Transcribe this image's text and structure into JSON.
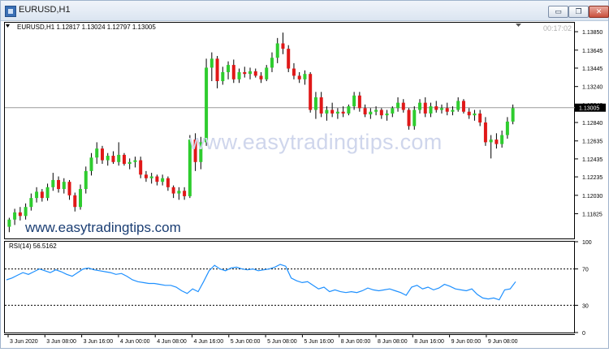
{
  "window": {
    "title": "EURUSD,H1",
    "controls": {
      "minimize": "▭",
      "restore": "❐",
      "close": "✕"
    }
  },
  "chart_info": {
    "symbol_line": "EURUSD,H1  1.12817 1.13024 1.12797 1.13005",
    "countdown": "00:17:02",
    "current_price": "1.13005"
  },
  "watermarks": {
    "center": "www.easytradingtips.com",
    "bottom_left": "www.easytradingtips.com"
  },
  "indicator": {
    "label": "RSI(14) 56.5162"
  },
  "colors": {
    "bull": "#2ecc2e",
    "bear": "#e01818",
    "rsi_line": "#1e90ff",
    "price_line": "#9a9a9a"
  },
  "chart_data": [
    {
      "type": "candlestick",
      "title": "EURUSD,H1",
      "ylim": [
        1.1155,
        1.1395
      ],
      "y_ticks": [
        "1.13850",
        "1.13645",
        "1.13445",
        "1.13240",
        "1.13040",
        "1.12840",
        "1.12635",
        "1.12435",
        "1.12235",
        "1.12030",
        "1.11825"
      ],
      "x_ticks": [
        "3 Jun 2020",
        "3 Jun 08:00",
        "3 Jun 16:00",
        "4 Jun 00:00",
        "4 Jun 08:00",
        "4 Jun 16:00",
        "5 Jun 00:00",
        "5 Jun 08:00",
        "5 Jun 16:00",
        "8 Jun 00:00",
        "8 Jun 08:00",
        "8 Jun 16:00",
        "9 Jun 00:00",
        "9 Jun 08:00"
      ],
      "current_price": 1.13005,
      "candles": [
        [
          1.1168,
          1.1178,
          1.1162,
          1.1176
        ],
        [
          1.1176,
          1.1188,
          1.117,
          1.1184
        ],
        [
          1.1184,
          1.119,
          1.1175,
          1.118
        ],
        [
          1.118,
          1.1194,
          1.1176,
          1.119
        ],
        [
          1.119,
          1.1205,
          1.1186,
          1.12
        ],
        [
          1.12,
          1.1212,
          1.1195,
          1.1207
        ],
        [
          1.1207,
          1.121,
          1.1196,
          1.12
        ],
        [
          1.12,
          1.1216,
          1.1197,
          1.1212
        ],
        [
          1.1212,
          1.1228,
          1.1208,
          1.122
        ],
        [
          1.122,
          1.1224,
          1.1206,
          1.121
        ],
        [
          1.121,
          1.1222,
          1.1205,
          1.1218
        ],
        [
          1.1218,
          1.122,
          1.1198,
          1.1203
        ],
        [
          1.1203,
          1.1206,
          1.1185,
          1.119
        ],
        [
          1.119,
          1.1215,
          1.1187,
          1.121
        ],
        [
          1.121,
          1.1235,
          1.1205,
          1.123
        ],
        [
          1.123,
          1.125,
          1.1225,
          1.1245
        ],
        [
          1.1245,
          1.1262,
          1.1238,
          1.1255
        ],
        [
          1.1255,
          1.1258,
          1.1238,
          1.1242
        ],
        [
          1.1242,
          1.125,
          1.1236,
          1.1247
        ],
        [
          1.1247,
          1.1252,
          1.1238,
          1.124
        ],
        [
          1.124,
          1.1262,
          1.1236,
          1.1248
        ],
        [
          1.1248,
          1.125,
          1.1236,
          1.1238
        ],
        [
          1.1238,
          1.1244,
          1.1232,
          1.124
        ],
        [
          1.124,
          1.1246,
          1.1234,
          1.1242
        ],
        [
          1.1242,
          1.1246,
          1.1222,
          1.1226
        ],
        [
          1.1226,
          1.123,
          1.1218,
          1.1222
        ],
        [
          1.1222,
          1.1228,
          1.1216,
          1.1224
        ],
        [
          1.1224,
          1.1226,
          1.1214,
          1.1218
        ],
        [
          1.1218,
          1.1226,
          1.1214,
          1.1222
        ],
        [
          1.1222,
          1.1224,
          1.1208,
          1.1212
        ],
        [
          1.1212,
          1.1214,
          1.12,
          1.1205
        ],
        [
          1.1205,
          1.1212,
          1.1198,
          1.1208
        ],
        [
          1.1208,
          1.1212,
          1.1198,
          1.1202
        ],
        [
          1.1202,
          1.127,
          1.12,
          1.1265
        ],
        [
          1.1265,
          1.1272,
          1.123,
          1.124
        ],
        [
          1.124,
          1.1268,
          1.1232,
          1.1262
        ],
        [
          1.1262,
          1.1355,
          1.1258,
          1.1345
        ],
        [
          1.1345,
          1.1362,
          1.133,
          1.1355
        ],
        [
          1.1355,
          1.1358,
          1.1322,
          1.133
        ],
        [
          1.133,
          1.1346,
          1.1326,
          1.134
        ],
        [
          1.134,
          1.1352,
          1.1332,
          1.1348
        ],
        [
          1.1348,
          1.1354,
          1.1328,
          1.1332
        ],
        [
          1.1332,
          1.1344,
          1.1328,
          1.134
        ],
        [
          1.134,
          1.1346,
          1.1334,
          1.1338
        ],
        [
          1.1338,
          1.1345,
          1.1332,
          1.1341
        ],
        [
          1.1341,
          1.1344,
          1.1334,
          1.1336
        ],
        [
          1.1336,
          1.134,
          1.1328,
          1.1332
        ],
        [
          1.1332,
          1.1348,
          1.133,
          1.1345
        ],
        [
          1.1345,
          1.1362,
          1.134,
          1.1356
        ],
        [
          1.1356,
          1.1378,
          1.135,
          1.1372
        ],
        [
          1.1372,
          1.1384,
          1.136,
          1.1366
        ],
        [
          1.1366,
          1.137,
          1.134,
          1.1344
        ],
        [
          1.1344,
          1.135,
          1.1332,
          1.1336
        ],
        [
          1.1336,
          1.134,
          1.1328,
          1.1332
        ],
        [
          1.1332,
          1.1342,
          1.1326,
          1.1338
        ],
        [
          1.1338,
          1.134,
          1.1295,
          1.1298
        ],
        [
          1.1298,
          1.1318,
          1.1288,
          1.1312
        ],
        [
          1.1312,
          1.1318,
          1.129,
          1.1294
        ],
        [
          1.1294,
          1.1302,
          1.1286,
          1.1298
        ],
        [
          1.1298,
          1.1306,
          1.129,
          1.1294
        ],
        [
          1.1294,
          1.13,
          1.1288,
          1.1296
        ],
        [
          1.1296,
          1.1302,
          1.129,
          1.1294
        ],
        [
          1.1294,
          1.1304,
          1.1292,
          1.1302
        ],
        [
          1.1302,
          1.1318,
          1.1298,
          1.1314
        ],
        [
          1.1314,
          1.1318,
          1.1296,
          1.13
        ],
        [
          1.13,
          1.1304,
          1.129,
          1.1293
        ],
        [
          1.1293,
          1.13,
          1.1288,
          1.1296
        ],
        [
          1.1296,
          1.1302,
          1.1292,
          1.1298
        ],
        [
          1.1298,
          1.13,
          1.1288,
          1.1292
        ],
        [
          1.1292,
          1.1298,
          1.1286,
          1.1294
        ],
        [
          1.1294,
          1.1302,
          1.129,
          1.13
        ],
        [
          1.13,
          1.1312,
          1.1296,
          1.1306
        ],
        [
          1.1306,
          1.131,
          1.1295,
          1.1298
        ],
        [
          1.1298,
          1.13,
          1.1276,
          1.128
        ],
        [
          1.128,
          1.1302,
          1.1276,
          1.1298
        ],
        [
          1.1298,
          1.131,
          1.1294,
          1.1306
        ],
        [
          1.1306,
          1.1312,
          1.129,
          1.1294
        ],
        [
          1.1294,
          1.1306,
          1.129,
          1.1302
        ],
        [
          1.1302,
          1.1308,
          1.1295,
          1.1298
        ],
        [
          1.1298,
          1.1304,
          1.1294,
          1.13
        ],
        [
          1.13,
          1.1306,
          1.1292,
          1.1296
        ],
        [
          1.1296,
          1.1302,
          1.1292,
          1.1298
        ],
        [
          1.1298,
          1.1312,
          1.1296,
          1.1308
        ],
        [
          1.1308,
          1.131,
          1.1294,
          1.1296
        ],
        [
          1.1296,
          1.13,
          1.1288,
          1.1292
        ],
        [
          1.1292,
          1.1298,
          1.1286,
          1.1294
        ],
        [
          1.1294,
          1.1298,
          1.128,
          1.1284
        ],
        [
          1.1284,
          1.129,
          1.1258,
          1.1262
        ],
        [
          1.1262,
          1.127,
          1.1244,
          1.1265
        ],
        [
          1.1265,
          1.1272,
          1.1255,
          1.126
        ],
        [
          1.126,
          1.1275,
          1.1256,
          1.127
        ],
        [
          1.127,
          1.129,
          1.1266,
          1.1285
        ],
        [
          1.1285,
          1.1304,
          1.1282,
          1.13
        ]
      ]
    },
    {
      "type": "line",
      "title": "RSI(14) 56.5162",
      "ylim": [
        0,
        100
      ],
      "y_ticks": [
        "100",
        "70",
        "30",
        "0"
      ],
      "levels": [
        70,
        30
      ],
      "values": [
        58,
        60,
        63,
        66,
        64,
        67,
        70,
        68,
        66,
        69,
        67,
        64,
        62,
        66,
        70,
        71,
        69,
        68,
        67,
        66,
        64,
        65,
        62,
        58,
        56,
        55,
        54,
        54,
        53,
        52,
        52,
        50,
        46,
        43,
        48,
        45,
        56,
        68,
        74,
        70,
        68,
        71,
        72,
        70,
        69,
        70,
        68,
        69,
        70,
        72,
        75,
        73,
        60,
        57,
        55,
        56,
        52,
        48,
        50,
        45,
        47,
        45,
        44,
        45,
        44,
        46,
        49,
        47,
        46,
        47,
        48,
        46,
        44,
        41,
        50,
        52,
        48,
        50,
        47,
        49,
        53,
        51,
        48,
        47,
        46,
        48,
        42,
        38,
        37,
        38,
        36,
        47,
        48,
        56
      ]
    }
  ]
}
